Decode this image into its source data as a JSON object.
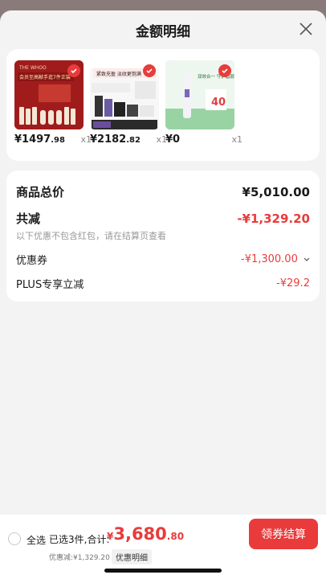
{
  "header": {
    "title": "金额明细"
  },
  "products": [
    {
      "price_main": "¥1497",
      "price_cents": ".98",
      "qty": "x1",
      "banner": "会员至高献手逛7件正装",
      "brand": "THE WHOO"
    },
    {
      "price_main": "¥2182",
      "price_cents": ".82",
      "qty": "x1",
      "banner": "紧致充盈 淡纹更饱满",
      "brand": ""
    },
    {
      "price_main": "¥0",
      "price_cents": "",
      "qty": "x1",
      "banner": "双效合一 守护眉弱肌",
      "badge_num": "40"
    }
  ],
  "summary": {
    "total_label": "商品总价",
    "total_value": "¥5,010.00",
    "reduce_label": "共减",
    "reduce_value": "-¥1,329.20",
    "reduce_note": "以下优惠不包含红包，请在结算页查看",
    "coupon_label": "优惠券",
    "coupon_value": "-¥1,300.00",
    "plus_label": "PLUS专享立减",
    "plus_value": "-¥29.2"
  },
  "bottom": {
    "select_all": "全选",
    "selected_info": "已选3件,合计:",
    "total_symbol": "¥",
    "total_main": "3,680",
    "total_cents": ".80",
    "discount_line": "优惠减:¥1,329.20",
    "detail_tag": "优惠明细",
    "checkout": "领券结算"
  },
  "colors": {
    "accent": "#e93b3b",
    "background": "#f3f3f3"
  }
}
